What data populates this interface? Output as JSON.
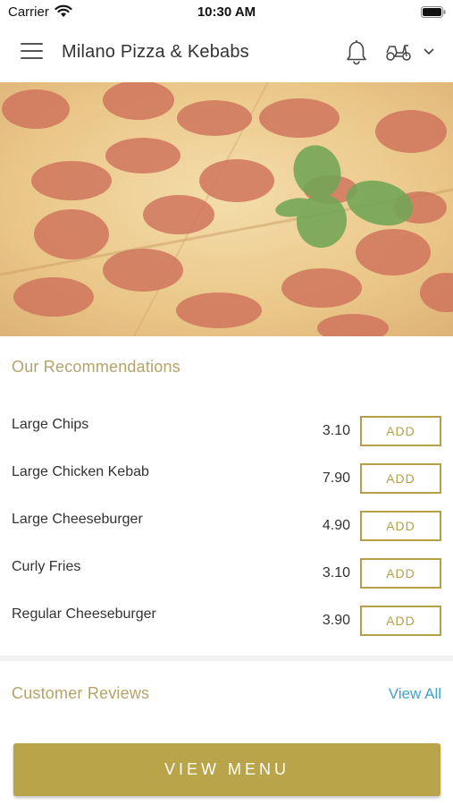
{
  "status_bar": {
    "carrier": "Carrier",
    "time": "10:30 AM"
  },
  "header": {
    "title": "Milano Pizza & Kebabs",
    "icons": [
      "menu-icon",
      "bell-icon",
      "scooter-icon",
      "chevron-down-icon"
    ]
  },
  "hero": {
    "image": "pepperoni-pizza-with-basil"
  },
  "recommendations": {
    "title": "Our Recommendations",
    "add_label": "ADD",
    "items": [
      {
        "name": "Large Chips",
        "price": "3.10"
      },
      {
        "name": "Large Chicken Kebab",
        "price": "7.90"
      },
      {
        "name": "Large Cheeseburger",
        "price": "4.90"
      },
      {
        "name": "Curly Fries",
        "price": "3.10"
      },
      {
        "name": "Regular Cheeseburger",
        "price": "3.90"
      }
    ]
  },
  "reviews": {
    "title": "Customer Reviews",
    "view_all": "View All"
  },
  "footer": {
    "view_menu": "VIEW MENU"
  },
  "colors": {
    "accent_gold": "#b5a048",
    "link_blue": "#3fa2c8",
    "section_title": "#b5a369"
  }
}
